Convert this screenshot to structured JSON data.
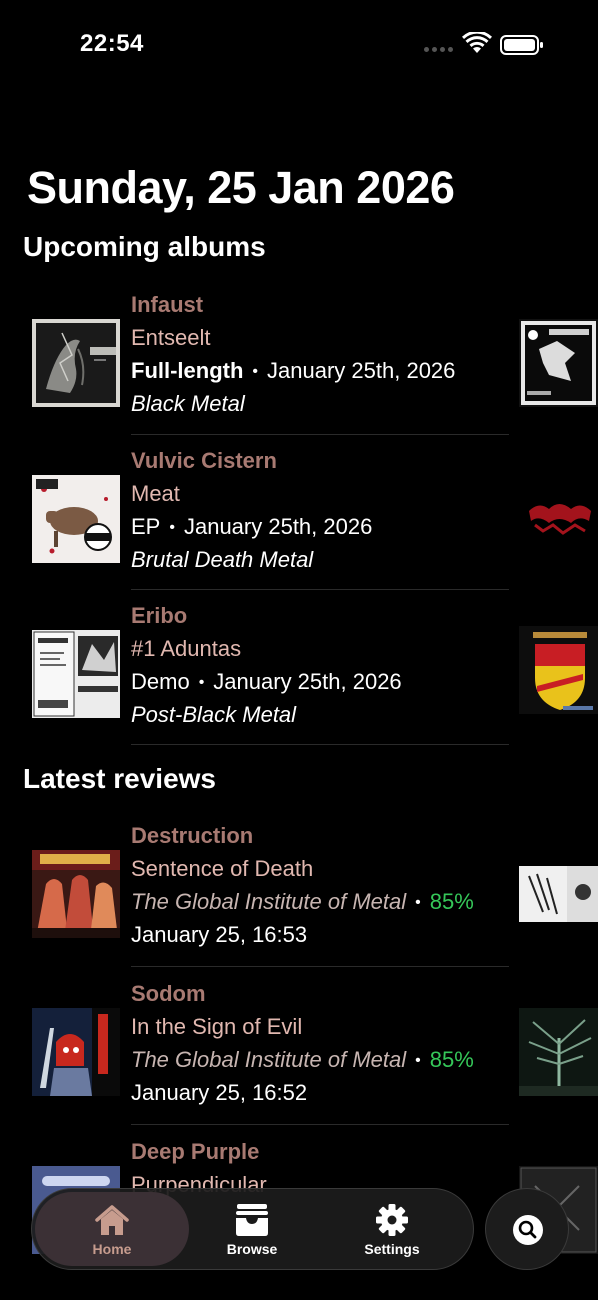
{
  "status_bar": {
    "time": "22:54"
  },
  "header": {
    "date": "Sunday, 25 Jan 2026"
  },
  "upcoming": {
    "title": "Upcoming albums",
    "items": [
      {
        "artist": "Infaust",
        "album": "Entseelt",
        "type": "Full-length",
        "date": "January 25th, 2026",
        "genre": "Black Metal"
      },
      {
        "artist": "Vulvic Cistern",
        "album": "Meat",
        "type": "EP",
        "date": "January 25th, 2026",
        "genre": "Brutal Death Metal"
      },
      {
        "artist": "Eribo",
        "album": "#1 Aduntas",
        "type": "Demo",
        "date": "January 25th, 2026",
        "genre": "Post-Black Metal"
      }
    ]
  },
  "reviews": {
    "title": "Latest reviews",
    "items": [
      {
        "artist": "Destruction",
        "album": "Sentence of Death",
        "source": "The Global Institute of Metal",
        "score": "85%",
        "date": "January 25, 16:53"
      },
      {
        "artist": "Sodom",
        "album": "In the Sign of Evil",
        "source": "The Global Institute of Metal",
        "score": "85%",
        "date": "January 25, 16:52"
      },
      {
        "artist": "Deep Purple",
        "album": "Purpendicular"
      }
    ]
  },
  "tabbar": {
    "tabs": [
      {
        "label": "Home",
        "icon": "house-icon",
        "active": true
      },
      {
        "label": "Browse",
        "icon": "tray-icon",
        "active": false
      },
      {
        "label": "Settings",
        "icon": "gear-icon",
        "active": false
      }
    ],
    "search_icon": "magnifier-icon"
  },
  "colors": {
    "artist": "#a87a72",
    "album": "#e1b8b0",
    "score": "#35c759",
    "active_tab": "#c79c8e"
  }
}
